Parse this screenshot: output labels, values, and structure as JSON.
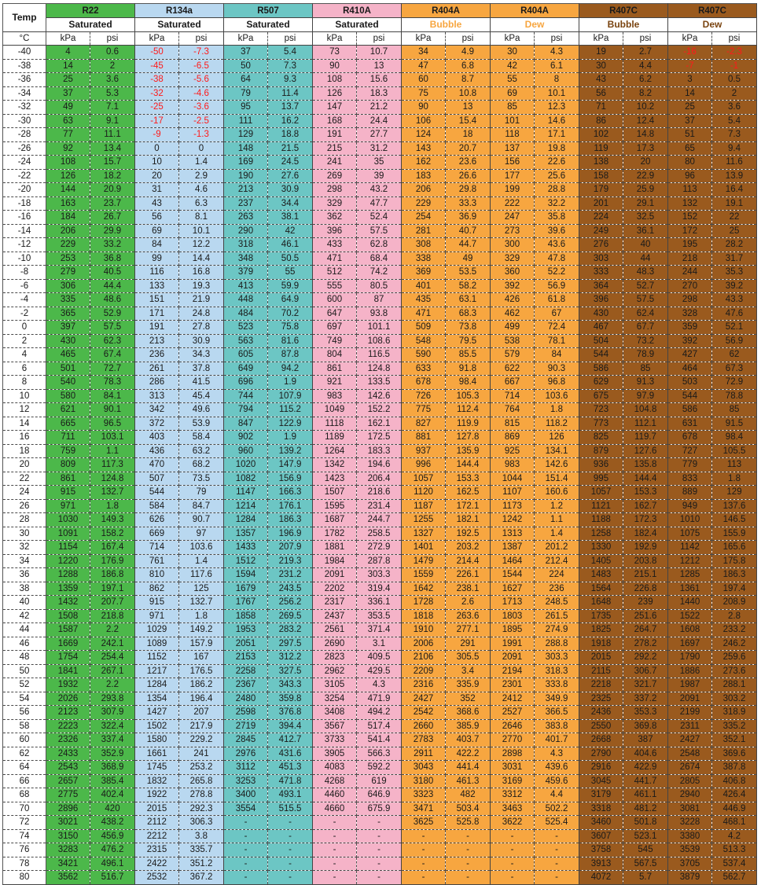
{
  "header": {
    "temp_label": "Temp",
    "temp_unit": "°C",
    "dash": "-"
  },
  "groups": [
    {
      "name": "R22",
      "state": "Saturated",
      "units": [
        "kPa",
        "psi"
      ],
      "color": "#4cb84a",
      "state_color": "#1a1a1a"
    },
    {
      "name": "R134a",
      "state": "Saturated",
      "units": [
        "kPa",
        "psi"
      ],
      "color": "#b9d8f0",
      "state_color": "#1a1a1a"
    },
    {
      "name": "R507",
      "state": "Saturated",
      "units": [
        "kPa",
        "psi"
      ],
      "color": "#6cc6c4",
      "state_color": "#1a1a1a"
    },
    {
      "name": "R410A",
      "state": "Saturated",
      "units": [
        "kPa",
        "psi"
      ],
      "color": "#f5b3c8",
      "state_color": "#1a1a1a"
    },
    {
      "name": "R404A",
      "state": "Bubble",
      "units": [
        "kPa",
        "psi"
      ],
      "color": "#f7a640",
      "state_color": "#f7a640"
    },
    {
      "name": "R404A",
      "state": "Dew",
      "units": [
        "kPa",
        "psi"
      ],
      "color": "#f7a640",
      "state_color": "#f7a640"
    },
    {
      "name": "R407C",
      "state": "Bubble",
      "units": [
        "kPa",
        "psi"
      ],
      "color": "#9a5a1e",
      "state_color": "#7a4410"
    },
    {
      "name": "R407C",
      "state": "Dew",
      "units": [
        "kPa",
        "psi"
      ],
      "color": "#9a5a1e",
      "state_color": "#7a4410"
    }
  ],
  "rows": [
    [
      "-40",
      "4",
      "0.6",
      "-50",
      "-7.3",
      "37",
      "5.4",
      "73",
      "10.7",
      "34",
      "4.9",
      "30",
      "4.3",
      "19",
      "2.7",
      "-16",
      "-2.3"
    ],
    [
      "-38",
      "14",
      "2",
      "-45",
      "-6.5",
      "50",
      "7.3",
      "90",
      "13",
      "47",
      "6.8",
      "42",
      "6.1",
      "30",
      "4.4",
      "-7",
      "-1"
    ],
    [
      "-36",
      "25",
      "3.6",
      "-38",
      "-5.6",
      "64",
      "9.3",
      "108",
      "15.6",
      "60",
      "8.7",
      "55",
      "8",
      "43",
      "6.2",
      "3",
      "0.5"
    ],
    [
      "-34",
      "37",
      "5.3",
      "-32",
      "-4.6",
      "79",
      "11.4",
      "126",
      "18.3",
      "75",
      "10.8",
      "69",
      "10.1",
      "56",
      "8.2",
      "14",
      "2"
    ],
    [
      "-32",
      "49",
      "7.1",
      "-25",
      "-3.6",
      "95",
      "13.7",
      "147",
      "21.2",
      "90",
      "13",
      "85",
      "12.3",
      "71",
      "10.2",
      "25",
      "3.6"
    ],
    [
      "-30",
      "63",
      "9.1",
      "-17",
      "-2.5",
      "111",
      "16.2",
      "168",
      "24.4",
      "106",
      "15.4",
      "101",
      "14.6",
      "86",
      "12.4",
      "37",
      "5.4"
    ],
    [
      "-28",
      "77",
      "11.1",
      "-9",
      "-1.3",
      "129",
      "18.8",
      "191",
      "27.7",
      "124",
      "18",
      "118",
      "17.1",
      "102",
      "14.8",
      "51",
      "7.3"
    ],
    [
      "-26",
      "92",
      "13.4",
      "0",
      "0",
      "148",
      "21.5",
      "215",
      "31.2",
      "143",
      "20.7",
      "137",
      "19.8",
      "119",
      "17.3",
      "65",
      "9.4"
    ],
    [
      "-24",
      "108",
      "15.7",
      "10",
      "1.4",
      "169",
      "24.5",
      "241",
      "35",
      "162",
      "23.6",
      "156",
      "22.6",
      "138",
      "20",
      "80",
      "11.6"
    ],
    [
      "-22",
      "126",
      "18.2",
      "20",
      "2.9",
      "190",
      "27.6",
      "269",
      "39",
      "183",
      "26.6",
      "177",
      "25.6",
      "158",
      "22.9",
      "96",
      "13.9"
    ],
    [
      "-20",
      "144",
      "20.9",
      "31",
      "4.6",
      "213",
      "30.9",
      "298",
      "43.2",
      "206",
      "29.8",
      "199",
      "28.8",
      "179",
      "25.9",
      "113",
      "16.4"
    ],
    [
      "-18",
      "163",
      "23.7",
      "43",
      "6.3",
      "237",
      "34.4",
      "329",
      "47.7",
      "229",
      "33.3",
      "222",
      "32.2",
      "201",
      "29.1",
      "132",
      "19.1"
    ],
    [
      "-16",
      "184",
      "26.7",
      "56",
      "8.1",
      "263",
      "38.1",
      "362",
      "52.4",
      "254",
      "36.9",
      "247",
      "35.8",
      "224",
      "32.5",
      "152",
      "22"
    ],
    [
      "-14",
      "206",
      "29.9",
      "69",
      "10.1",
      "290",
      "42",
      "396",
      "57.5",
      "281",
      "40.7",
      "273",
      "39.6",
      "249",
      "36.1",
      "172",
      "25"
    ],
    [
      "-12",
      "229",
      "33.2",
      "84",
      "12.2",
      "318",
      "46.1",
      "433",
      "62.8",
      "308",
      "44.7",
      "300",
      "43.6",
      "276",
      "40",
      "195",
      "28.2"
    ],
    [
      "-10",
      "253",
      "36.8",
      "99",
      "14.4",
      "348",
      "50.5",
      "471",
      "68.4",
      "338",
      "49",
      "329",
      "47.8",
      "303",
      "44",
      "218",
      "31.7"
    ],
    [
      "-8",
      "279",
      "40.5",
      "116",
      "16.8",
      "379",
      "55",
      "512",
      "74.2",
      "369",
      "53.5",
      "360",
      "52.2",
      "333",
      "48.3",
      "244",
      "35.3"
    ],
    [
      "-6",
      "306",
      "44.4",
      "133",
      "19.3",
      "413",
      "59.9",
      "555",
      "80.5",
      "401",
      "58.2",
      "392",
      "56.9",
      "364",
      "52.7",
      "270",
      "39.2"
    ],
    [
      "-4",
      "335",
      "48.6",
      "151",
      "21.9",
      "448",
      "64.9",
      "600",
      "87",
      "435",
      "63.1",
      "426",
      "61.8",
      "396",
      "57.5",
      "298",
      "43.3"
    ],
    [
      "-2",
      "365",
      "52.9",
      "171",
      "24.8",
      "484",
      "70.2",
      "647",
      "93.8",
      "471",
      "68.3",
      "462",
      "67",
      "430",
      "62.4",
      "328",
      "47.6"
    ],
    [
      "0",
      "397",
      "57.5",
      "191",
      "27.8",
      "523",
      "75.8",
      "697",
      "101.1",
      "509",
      "73.8",
      "499",
      "72.4",
      "467",
      "67.7",
      "359",
      "52.1"
    ],
    [
      "2",
      "430",
      "62.3",
      "213",
      "30.9",
      "563",
      "81.6",
      "749",
      "108.6",
      "548",
      "79.5",
      "538",
      "78.1",
      "504",
      "73.2",
      "392",
      "56.9"
    ],
    [
      "4",
      "465",
      "67.4",
      "236",
      "34.3",
      "605",
      "87.8",
      "804",
      "116.5",
      "590",
      "85.5",
      "579",
      "84",
      "544",
      "78.9",
      "427",
      "62"
    ],
    [
      "6",
      "501",
      "72.7",
      "261",
      "37.8",
      "649",
      "94.2",
      "861",
      "124.8",
      "633",
      "91.8",
      "622",
      "90.3",
      "586",
      "85",
      "464",
      "67.3"
    ],
    [
      "8",
      "540",
      "78.3",
      "286",
      "41.5",
      "696",
      "1.9",
      "921",
      "133.5",
      "678",
      "98.4",
      "667",
      "96.8",
      "629",
      "91.3",
      "503",
      "72.9"
    ],
    [
      "10",
      "580",
      "84.1",
      "313",
      "45.4",
      "744",
      "107.9",
      "983",
      "142.6",
      "726",
      "105.3",
      "714",
      "103.6",
      "675",
      "97.9",
      "544",
      "78.8"
    ],
    [
      "12",
      "621",
      "90.1",
      "342",
      "49.6",
      "794",
      "115.2",
      "1049",
      "152.2",
      "775",
      "112.4",
      "764",
      "1.8",
      "723",
      "104.8",
      "586",
      "85"
    ],
    [
      "14",
      "665",
      "96.5",
      "372",
      "53.9",
      "847",
      "122.9",
      "1118",
      "162.1",
      "827",
      "119.9",
      "815",
      "118.2",
      "773",
      "112.1",
      "631",
      "91.5"
    ],
    [
      "16",
      "711",
      "103.1",
      "403",
      "58.4",
      "902",
      "1.9",
      "1189",
      "172.5",
      "881",
      "127.8",
      "869",
      "126",
      "825",
      "119.7",
      "678",
      "98.4"
    ],
    [
      "18",
      "759",
      "1.1",
      "436",
      "63.2",
      "960",
      "139.2",
      "1264",
      "183.3",
      "937",
      "135.9",
      "925",
      "134.1",
      "879",
      "127.6",
      "727",
      "105.5"
    ],
    [
      "20",
      "809",
      "117.3",
      "470",
      "68.2",
      "1020",
      "147.9",
      "1342",
      "194.6",
      "996",
      "144.4",
      "983",
      "142.6",
      "936",
      "135.8",
      "779",
      "113"
    ],
    [
      "22",
      "861",
      "124.8",
      "507",
      "73.5",
      "1082",
      "156.9",
      "1423",
      "206.4",
      "1057",
      "153.3",
      "1044",
      "151.4",
      "995",
      "144.4",
      "833",
      "1.8"
    ],
    [
      "24",
      "915",
      "132.7",
      "544",
      "79",
      "1147",
      "166.3",
      "1507",
      "218.6",
      "1120",
      "162.5",
      "1107",
      "160.6",
      "1057",
      "153.3",
      "889",
      "129"
    ],
    [
      "26",
      "971",
      "1.8",
      "584",
      "84.7",
      "1214",
      "176.1",
      "1595",
      "231.4",
      "1187",
      "172.1",
      "1173",
      "1.2",
      "1121",
      "162.7",
      "949",
      "137.6"
    ],
    [
      "28",
      "1030",
      "149.3",
      "626",
      "90.7",
      "1284",
      "186.3",
      "1687",
      "244.7",
      "1255",
      "182.1",
      "1242",
      "1.1",
      "1188",
      "172.3",
      "1010",
      "146.5"
    ],
    [
      "30",
      "1091",
      "158.2",
      "669",
      "97",
      "1357",
      "196.9",
      "1782",
      "258.5",
      "1327",
      "192.5",
      "1313",
      "1.4",
      "1258",
      "182.4",
      "1075",
      "155.9"
    ],
    [
      "32",
      "1154",
      "167.4",
      "714",
      "103.6",
      "1433",
      "207.9",
      "1881",
      "272.9",
      "1401",
      "203.2",
      "1387",
      "201.2",
      "1330",
      "192.9",
      "1142",
      "165.6"
    ],
    [
      "34",
      "1220",
      "176.9",
      "761",
      "1.4",
      "1512",
      "219.3",
      "1984",
      "287.8",
      "1479",
      "214.4",
      "1464",
      "212.4",
      "1405",
      "203.8",
      "1212",
      "175.8"
    ],
    [
      "36",
      "1288",
      "186.8",
      "810",
      "117.6",
      "1594",
      "231.2",
      "2091",
      "303.3",
      "1559",
      "226.1",
      "1544",
      "224",
      "1483",
      "215.1",
      "1285",
      "186.3"
    ],
    [
      "38",
      "1359",
      "197.1",
      "862",
      "125",
      "1679",
      "243.5",
      "2202",
      "319.4",
      "1642",
      "238.1",
      "1627",
      "236",
      "1564",
      "226.8",
      "1361",
      "197.4"
    ],
    [
      "40",
      "1432",
      "207.7",
      "915",
      "132.7",
      "1767",
      "256.2",
      "2317",
      "336.1",
      "1728",
      "2.6",
      "1713",
      "248.5",
      "1648",
      "239",
      "1440",
      "208.9"
    ],
    [
      "42",
      "1508",
      "218.8",
      "971",
      "1.8",
      "1858",
      "269.5",
      "2437",
      "353.5",
      "1818",
      "263.6",
      "1803",
      "261.5",
      "1735",
      "251.6",
      "1522",
      "2.8"
    ],
    [
      "44",
      "1587",
      "2.2",
      "1029",
      "149.2",
      "1953",
      "283.2",
      "2561",
      "371.4",
      "1910",
      "277.1",
      "1895",
      "274.9",
      "1825",
      "264.7",
      "1608",
      "233.2"
    ],
    [
      "46",
      "1669",
      "242.1",
      "1089",
      "157.9",
      "2051",
      "297.5",
      "2690",
      "3.1",
      "2006",
      "291",
      "1991",
      "288.8",
      "1918",
      "278.2",
      "1697",
      "246.2"
    ],
    [
      "48",
      "1754",
      "254.4",
      "1152",
      "167",
      "2153",
      "312.2",
      "2823",
      "409.5",
      "2106",
      "305.5",
      "2091",
      "303.3",
      "2015",
      "292.2",
      "1790",
      "259.6"
    ],
    [
      "50",
      "1841",
      "267.1",
      "1217",
      "176.5",
      "2258",
      "327.5",
      "2962",
      "429.5",
      "2209",
      "3.4",
      "2194",
      "318.3",
      "2115",
      "306.7",
      "1886",
      "273.6"
    ],
    [
      "52",
      "1932",
      "2.2",
      "1284",
      "186.2",
      "2367",
      "343.3",
      "3105",
      "4.3",
      "2316",
      "335.9",
      "2301",
      "333.8",
      "2218",
      "321.7",
      "1987",
      "288.1"
    ],
    [
      "54",
      "2026",
      "293.8",
      "1354",
      "196.4",
      "2480",
      "359.8",
      "3254",
      "471.9",
      "2427",
      "352",
      "2412",
      "349.9",
      "2325",
      "337.2",
      "2091",
      "303.2"
    ],
    [
      "56",
      "2123",
      "307.9",
      "1427",
      "207",
      "2598",
      "376.8",
      "3408",
      "494.2",
      "2542",
      "368.6",
      "2527",
      "366.5",
      "2436",
      "353.3",
      "2199",
      "318.9"
    ],
    [
      "58",
      "2223",
      "322.4",
      "1502",
      "217.9",
      "2719",
      "394.4",
      "3567",
      "517.4",
      "2660",
      "385.9",
      "2646",
      "383.8",
      "2550",
      "369.8",
      "2311",
      "335.2"
    ],
    [
      "60",
      "2326",
      "337.4",
      "1580",
      "229.2",
      "2845",
      "412.7",
      "3733",
      "541.4",
      "2783",
      "403.7",
      "2770",
      "401.7",
      "2668",
      "387",
      "2427",
      "352.1"
    ],
    [
      "62",
      "2433",
      "352.9",
      "1661",
      "241",
      "2976",
      "431.6",
      "3905",
      "566.3",
      "2911",
      "422.2",
      "2898",
      "4.3",
      "2790",
      "404.6",
      "2548",
      "369.6"
    ],
    [
      "64",
      "2543",
      "368.9",
      "1745",
      "253.2",
      "3112",
      "451.3",
      "4083",
      "592.2",
      "3043",
      "441.4",
      "3031",
      "439.6",
      "2916",
      "422.9",
      "2674",
      "387.8"
    ],
    [
      "66",
      "2657",
      "385.4",
      "1832",
      "265.8",
      "3253",
      "471.8",
      "4268",
      "619",
      "3180",
      "461.3",
      "3169",
      "459.6",
      "3045",
      "441.7",
      "2805",
      "406.8"
    ],
    [
      "68",
      "2775",
      "402.4",
      "1922",
      "278.8",
      "3400",
      "493.1",
      "4460",
      "646.9",
      "3323",
      "482",
      "3312",
      "4.4",
      "3179",
      "461.1",
      "2940",
      "426.4"
    ],
    [
      "70",
      "2896",
      "420",
      "2015",
      "292.3",
      "3554",
      "515.5",
      "4660",
      "675.9",
      "3471",
      "503.4",
      "3463",
      "502.2",
      "3318",
      "481.2",
      "3081",
      "446.9"
    ],
    [
      "72",
      "3021",
      "438.2",
      "2112",
      "306.3",
      "-",
      "-",
      "-",
      "-",
      "3625",
      "525.8",
      "3622",
      "525.4",
      "3460",
      "501.8",
      "3228",
      "468.1"
    ],
    [
      "74",
      "3150",
      "456.9",
      "2212",
      "3.8",
      "-",
      "-",
      "-",
      "-",
      "-",
      "-",
      "-",
      "-",
      "3607",
      "523.1",
      "3380",
      "4.2"
    ],
    [
      "76",
      "3283",
      "476.2",
      "2315",
      "335.7",
      "-",
      "-",
      "-",
      "-",
      "-",
      "-",
      "-",
      "-",
      "3758",
      "545",
      "3539",
      "513.3"
    ],
    [
      "78",
      "3421",
      "496.1",
      "2422",
      "351.2",
      "-",
      "-",
      "-",
      "-",
      "-",
      "-",
      "-",
      "-",
      "3913",
      "567.5",
      "3705",
      "537.4"
    ],
    [
      "80",
      "3562",
      "516.7",
      "2532",
      "367.2",
      "-",
      "-",
      "-",
      "-",
      "-",
      "-",
      "-",
      "-",
      "4072",
      "5.7",
      "3879",
      "562.7"
    ]
  ]
}
